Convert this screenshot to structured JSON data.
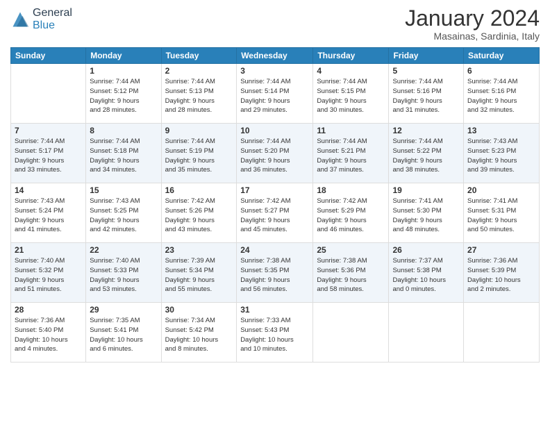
{
  "header": {
    "logo_general": "General",
    "logo_blue": "Blue",
    "month_title": "January 2024",
    "location": "Masainas, Sardinia, Italy"
  },
  "days_of_week": [
    "Sunday",
    "Monday",
    "Tuesday",
    "Wednesday",
    "Thursday",
    "Friday",
    "Saturday"
  ],
  "weeks": [
    [
      {
        "day": "",
        "info": ""
      },
      {
        "day": "1",
        "info": "Sunrise: 7:44 AM\nSunset: 5:12 PM\nDaylight: 9 hours\nand 28 minutes."
      },
      {
        "day": "2",
        "info": "Sunrise: 7:44 AM\nSunset: 5:13 PM\nDaylight: 9 hours\nand 28 minutes."
      },
      {
        "day": "3",
        "info": "Sunrise: 7:44 AM\nSunset: 5:14 PM\nDaylight: 9 hours\nand 29 minutes."
      },
      {
        "day": "4",
        "info": "Sunrise: 7:44 AM\nSunset: 5:15 PM\nDaylight: 9 hours\nand 30 minutes."
      },
      {
        "day": "5",
        "info": "Sunrise: 7:44 AM\nSunset: 5:16 PM\nDaylight: 9 hours\nand 31 minutes."
      },
      {
        "day": "6",
        "info": "Sunrise: 7:44 AM\nSunset: 5:16 PM\nDaylight: 9 hours\nand 32 minutes."
      }
    ],
    [
      {
        "day": "7",
        "info": "Sunrise: 7:44 AM\nSunset: 5:17 PM\nDaylight: 9 hours\nand 33 minutes."
      },
      {
        "day": "8",
        "info": "Sunrise: 7:44 AM\nSunset: 5:18 PM\nDaylight: 9 hours\nand 34 minutes."
      },
      {
        "day": "9",
        "info": "Sunrise: 7:44 AM\nSunset: 5:19 PM\nDaylight: 9 hours\nand 35 minutes."
      },
      {
        "day": "10",
        "info": "Sunrise: 7:44 AM\nSunset: 5:20 PM\nDaylight: 9 hours\nand 36 minutes."
      },
      {
        "day": "11",
        "info": "Sunrise: 7:44 AM\nSunset: 5:21 PM\nDaylight: 9 hours\nand 37 minutes."
      },
      {
        "day": "12",
        "info": "Sunrise: 7:44 AM\nSunset: 5:22 PM\nDaylight: 9 hours\nand 38 minutes."
      },
      {
        "day": "13",
        "info": "Sunrise: 7:43 AM\nSunset: 5:23 PM\nDaylight: 9 hours\nand 39 minutes."
      }
    ],
    [
      {
        "day": "14",
        "info": "Sunrise: 7:43 AM\nSunset: 5:24 PM\nDaylight: 9 hours\nand 41 minutes."
      },
      {
        "day": "15",
        "info": "Sunrise: 7:43 AM\nSunset: 5:25 PM\nDaylight: 9 hours\nand 42 minutes."
      },
      {
        "day": "16",
        "info": "Sunrise: 7:42 AM\nSunset: 5:26 PM\nDaylight: 9 hours\nand 43 minutes."
      },
      {
        "day": "17",
        "info": "Sunrise: 7:42 AM\nSunset: 5:27 PM\nDaylight: 9 hours\nand 45 minutes."
      },
      {
        "day": "18",
        "info": "Sunrise: 7:42 AM\nSunset: 5:29 PM\nDaylight: 9 hours\nand 46 minutes."
      },
      {
        "day": "19",
        "info": "Sunrise: 7:41 AM\nSunset: 5:30 PM\nDaylight: 9 hours\nand 48 minutes."
      },
      {
        "day": "20",
        "info": "Sunrise: 7:41 AM\nSunset: 5:31 PM\nDaylight: 9 hours\nand 50 minutes."
      }
    ],
    [
      {
        "day": "21",
        "info": "Sunrise: 7:40 AM\nSunset: 5:32 PM\nDaylight: 9 hours\nand 51 minutes."
      },
      {
        "day": "22",
        "info": "Sunrise: 7:40 AM\nSunset: 5:33 PM\nDaylight: 9 hours\nand 53 minutes."
      },
      {
        "day": "23",
        "info": "Sunrise: 7:39 AM\nSunset: 5:34 PM\nDaylight: 9 hours\nand 55 minutes."
      },
      {
        "day": "24",
        "info": "Sunrise: 7:38 AM\nSunset: 5:35 PM\nDaylight: 9 hours\nand 56 minutes."
      },
      {
        "day": "25",
        "info": "Sunrise: 7:38 AM\nSunset: 5:36 PM\nDaylight: 9 hours\nand 58 minutes."
      },
      {
        "day": "26",
        "info": "Sunrise: 7:37 AM\nSunset: 5:38 PM\nDaylight: 10 hours\nand 0 minutes."
      },
      {
        "day": "27",
        "info": "Sunrise: 7:36 AM\nSunset: 5:39 PM\nDaylight: 10 hours\nand 2 minutes."
      }
    ],
    [
      {
        "day": "28",
        "info": "Sunrise: 7:36 AM\nSunset: 5:40 PM\nDaylight: 10 hours\nand 4 minutes."
      },
      {
        "day": "29",
        "info": "Sunrise: 7:35 AM\nSunset: 5:41 PM\nDaylight: 10 hours\nand 6 minutes."
      },
      {
        "day": "30",
        "info": "Sunrise: 7:34 AM\nSunset: 5:42 PM\nDaylight: 10 hours\nand 8 minutes."
      },
      {
        "day": "31",
        "info": "Sunrise: 7:33 AM\nSunset: 5:43 PM\nDaylight: 10 hours\nand 10 minutes."
      },
      {
        "day": "",
        "info": ""
      },
      {
        "day": "",
        "info": ""
      },
      {
        "day": "",
        "info": ""
      }
    ]
  ]
}
